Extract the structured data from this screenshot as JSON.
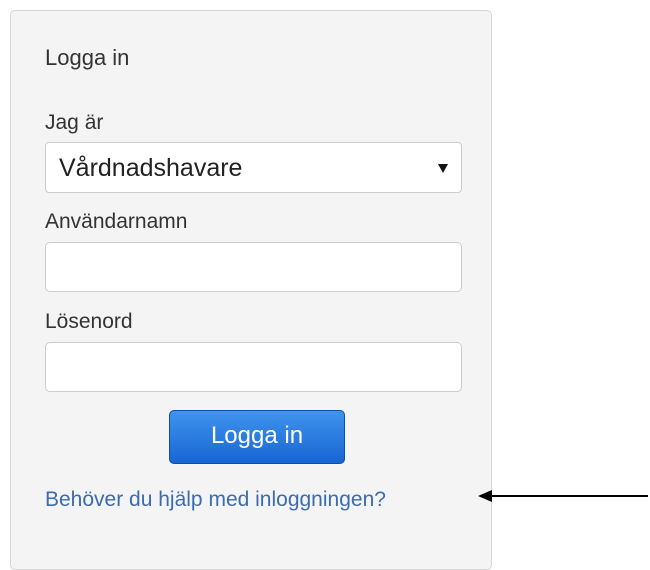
{
  "login": {
    "title": "Logga in",
    "role_label": "Jag är",
    "role_value": "Vårdnadshavare",
    "username_label": "Användarnamn",
    "username_value": "",
    "password_label": "Lösenord",
    "password_value": "",
    "submit_label": "Logga in",
    "help_link": "Behöver du hjälp med inloggningen?"
  },
  "annotation": {
    "icon": "left-arrow-icon",
    "color": "#000000"
  },
  "colors": {
    "button": "#1f6fdc",
    "link": "#3c6bb0",
    "panel": "#f4f4f4"
  }
}
